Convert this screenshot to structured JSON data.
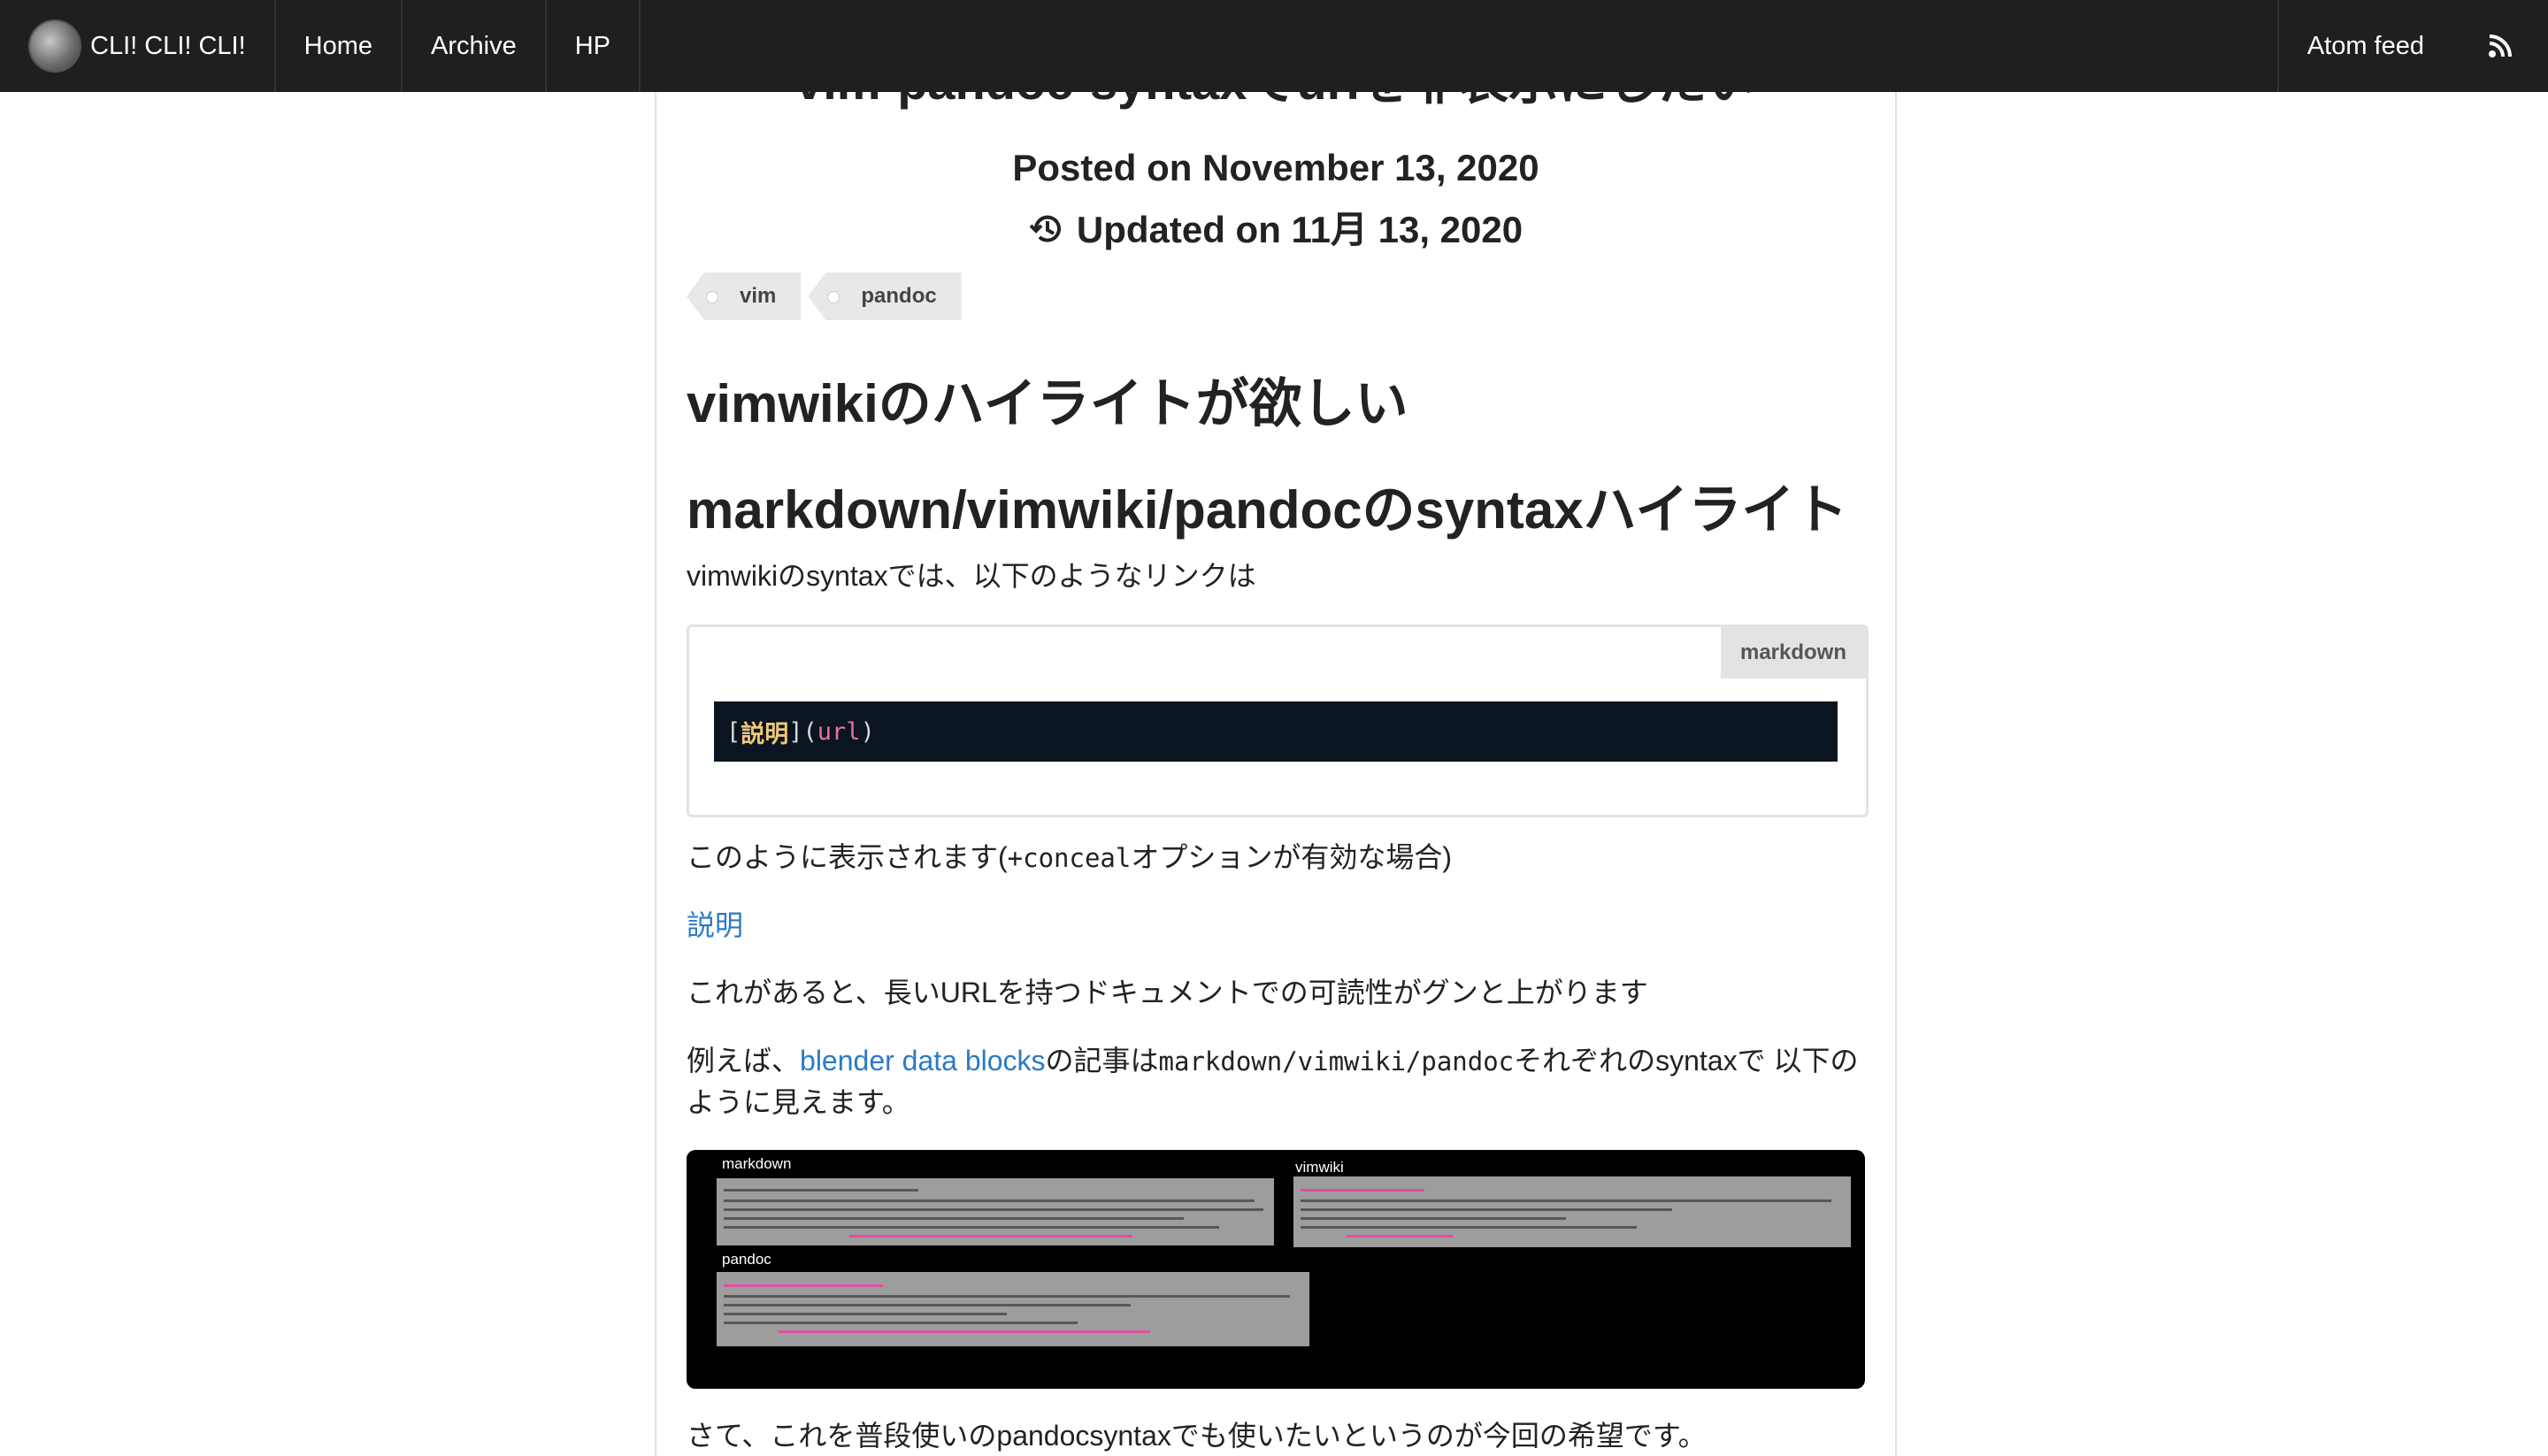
{
  "navbar": {
    "brand": "CLI! CLI! CLI!",
    "items": [
      "Home",
      "Archive",
      "HP"
    ],
    "atom_feed": "Atom feed"
  },
  "article": {
    "title_partial": "vim-pandoc-syntaxでurlを非表示にしたい",
    "posted": "Posted on November 13, 2020",
    "updated": "Updated on 11月 13, 2020",
    "tags": [
      "vim",
      "pandoc"
    ],
    "heading1": "vimwikiのハイライトが欲しい",
    "heading2": "markdown/vimwiki/pandocのsyntaxハイライト",
    "para1": "vimwikiのsyntaxでは、以下のようなリンクは",
    "code": {
      "lang": "markdown",
      "open_bracket": "[",
      "text": "説明",
      "mid": "](",
      "url": "url",
      "close": ")"
    },
    "para2_pre": "このように表示されます(",
    "para2_code": "+conceal",
    "para2_post": "オプションが有効な場合)",
    "link_example": "説明",
    "para3": "これがあると、長いURLを持つドキュメントでの可読性がグンと上がります",
    "para4_pre": "例えば、",
    "para4_link": "blender data blocks",
    "para4_mid": "の記事は",
    "para4_code": "markdown/vimwiki/pandoc",
    "para4_post": "それぞれのsyntaxで 以下のように見えます。",
    "screenshot": {
      "labels": [
        "markdown",
        "vimwiki",
        "pandoc"
      ]
    },
    "para5": "さて、これを普段使いのpandocsyntaxでも使いたいというのが今回の希望です。"
  },
  "colors": {
    "navbar_bg": "#1f1f1f",
    "link": "#2a7ac5",
    "code_bg": "#0b1522"
  }
}
